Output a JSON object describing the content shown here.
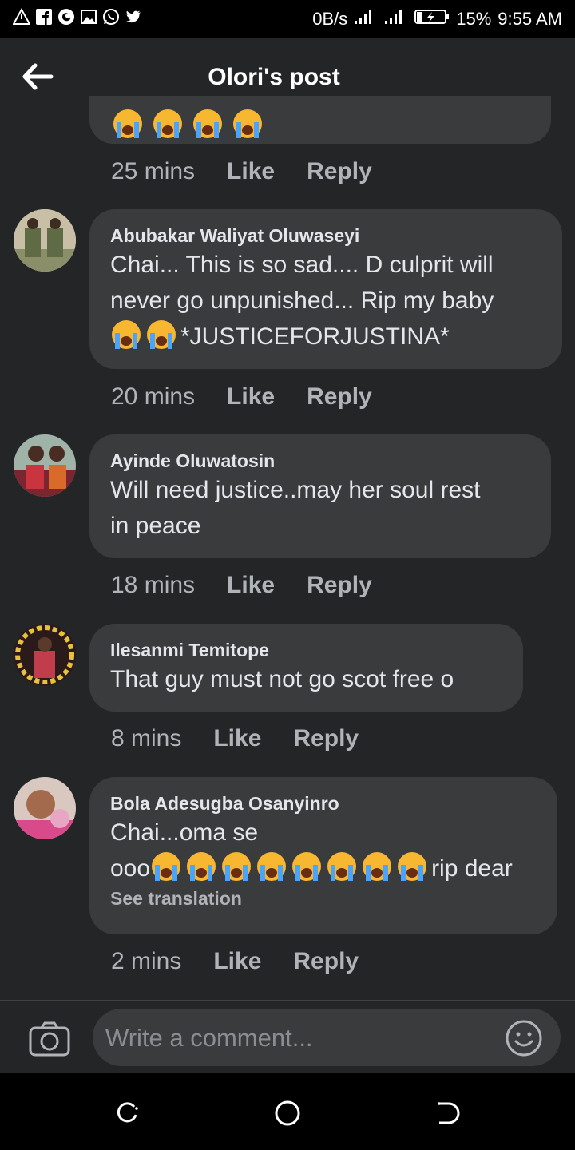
{
  "status_bar": {
    "network_speed": "0B/s",
    "battery": "15%",
    "time": "9:55 AM",
    "left_icons": [
      "warning-icon",
      "facebook-icon",
      "app-icon",
      "gallery-icon",
      "whatsapp-icon",
      "twitter-icon"
    ]
  },
  "header": {
    "title": "Olori's post"
  },
  "comments": [
    {
      "time": "25 mins",
      "like": "Like",
      "reply": "Reply"
    },
    {
      "name": "Abubakar Waliyat Oluwaseyi",
      "line1": "Chai... This is so sad.... D culprit will",
      "line2": "never go unpunished... Rip my baby",
      "line3": "*JUSTICEFORJUSTINA*",
      "time": "20 mins",
      "like": "Like",
      "reply": "Reply"
    },
    {
      "name": "Ayinde Oluwatosin",
      "line1": "Will need justice..may her soul rest",
      "line2": "in peace",
      "time": "18 mins",
      "like": "Like",
      "reply": "Reply"
    },
    {
      "name": "Ilesanmi Temitope",
      "line1": "That guy must not go scot free o",
      "time": "8 mins",
      "like": "Like",
      "reply": "Reply"
    },
    {
      "name": "Bola Adesugba Osanyinro",
      "line1": "Chai...oma se",
      "line2_prefix": "ooo",
      "line2_suffix": "rip dear",
      "see_translation": "See translation",
      "time": "2 mins",
      "like": "Like",
      "reply": "Reply"
    }
  ],
  "composer": {
    "placeholder": "Write a comment..."
  },
  "colors": {
    "background": "#242526",
    "bubble": "#3a3b3c",
    "text": "#e4e6eb",
    "muted": "#b0b3b8"
  }
}
